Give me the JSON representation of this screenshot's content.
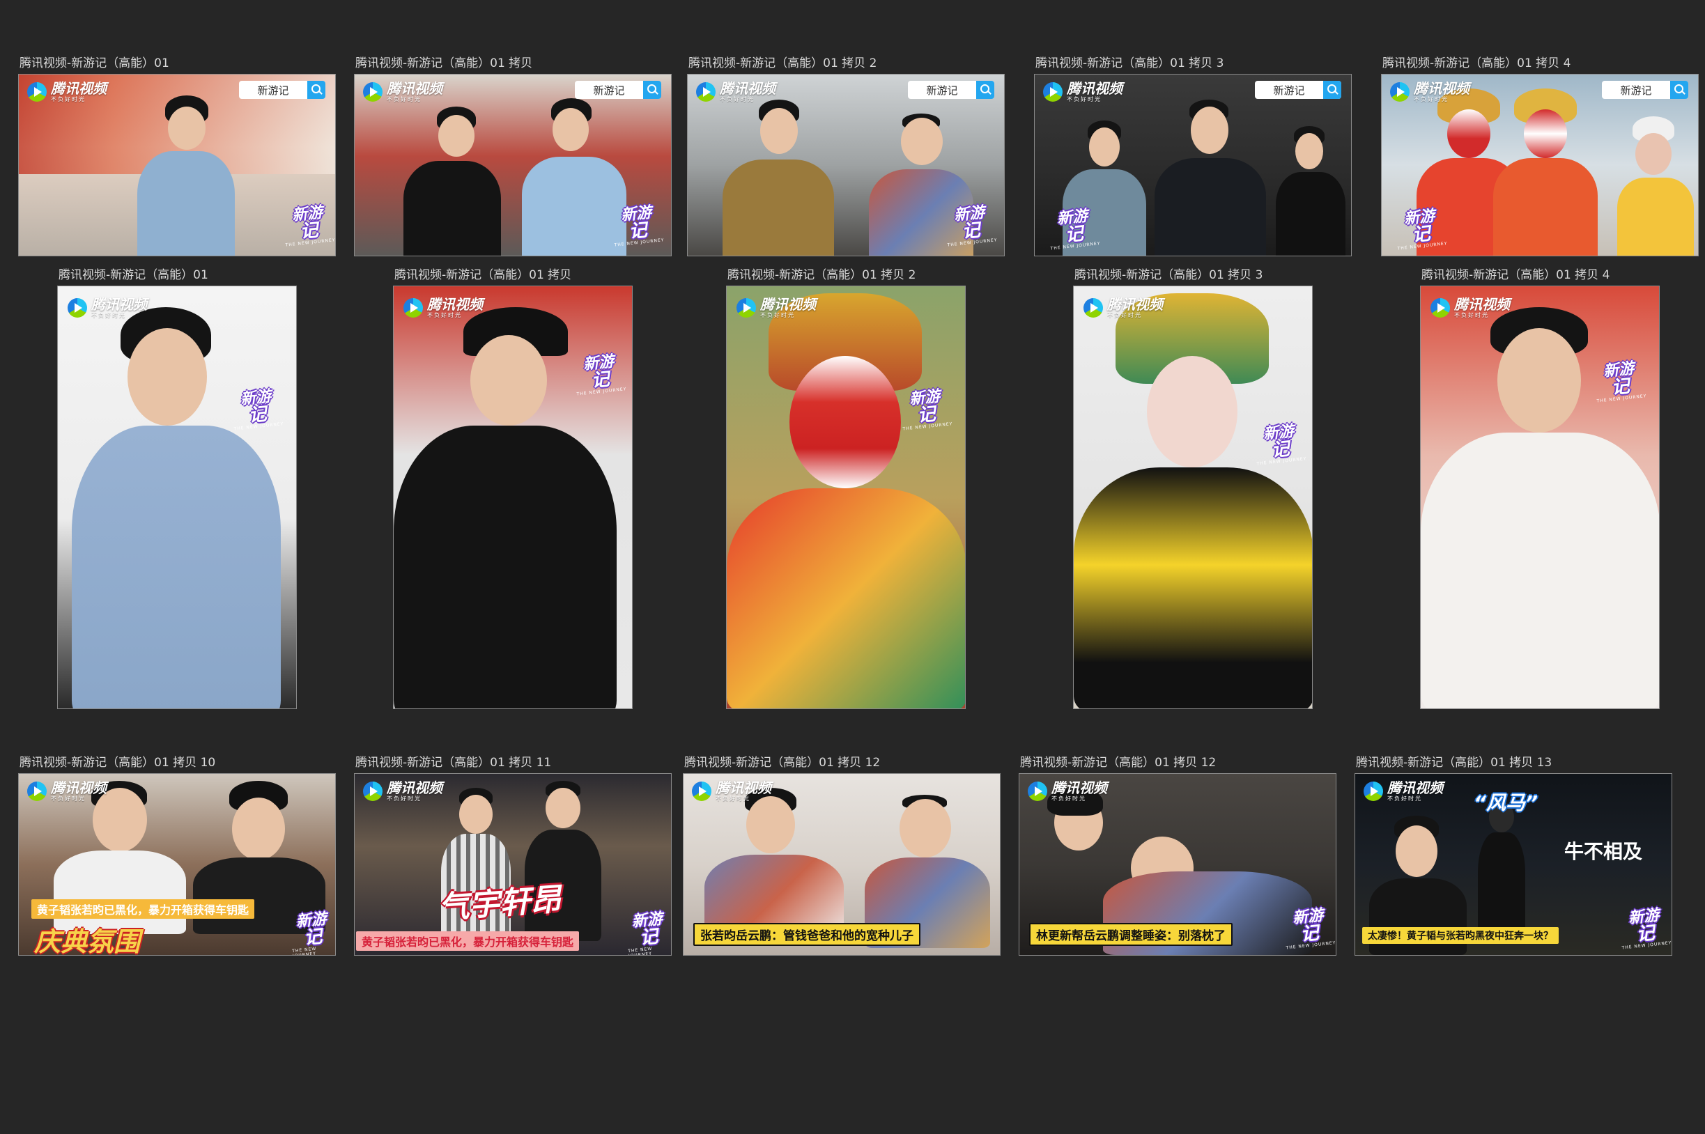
{
  "brand": {
    "logo_text": "腾讯视频",
    "logo_slogan": "不负好时光",
    "search_text": "新游记",
    "show_logo_main": "新游",
    "show_logo_num": "记",
    "show_logo_sub": "THE NEW JOURNEY"
  },
  "row1": [
    {
      "label": "腾讯视频-新游记（高能）01"
    },
    {
      "label": "腾讯视频-新游记（高能）01 拷贝"
    },
    {
      "label": "腾讯视频-新游记（高能）01 拷贝 2"
    },
    {
      "label": "腾讯视频-新游记（高能）01 拷贝 3"
    },
    {
      "label": "腾讯视频-新游记（高能）01 拷贝 4"
    }
  ],
  "row2": [
    {
      "label": "腾讯视频-新游记（高能）01"
    },
    {
      "label": "腾讯视频-新游记（高能）01 拷贝"
    },
    {
      "label": "腾讯视频-新游记（高能）01 拷贝 2"
    },
    {
      "label": "腾讯视频-新游记（高能）01 拷贝 3"
    },
    {
      "label": "腾讯视频-新游记（高能）01 拷贝 4"
    }
  ],
  "row3": [
    {
      "label": "腾讯视频-新游记（高能）01 拷贝 10",
      "subtitle": "黄子韬张若昀已黑化，暴力开箱获得车钥匙",
      "title": "庆典氛围"
    },
    {
      "label": "腾讯视频-新游记（高能）01 拷贝 11",
      "subtitle": "黄子韬张若昀已黑化，暴力开箱获得车钥匙",
      "title": "气宇轩昂"
    },
    {
      "label": "腾讯视频-新游记（高能）01 拷贝 12",
      "subtitle": "张若昀岳云鹏：管钱爸爸和他的宽种儿子"
    },
    {
      "label": "腾讯视频-新游记（高能）01 拷贝 12",
      "subtitle": "林更新帮岳云鹏调整睡姿：别落枕了"
    },
    {
      "label": "腾讯视频-新游记（高能）01 拷贝 13",
      "subtitle": "太凄惨！黄子韬与张若昀黑夜中狂奔一块？",
      "title": "牛不相及",
      "badge": "“风马”"
    }
  ]
}
